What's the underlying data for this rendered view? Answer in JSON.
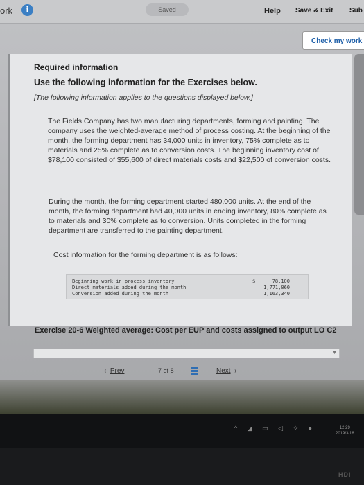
{
  "topbar": {
    "left_fragment": "ork",
    "info_glyph": "i",
    "saved_label": "Saved",
    "help_label": "Help",
    "save_exit_label": "Save & Exit",
    "submit_fragment": "Sub"
  },
  "check_button": "Check my work",
  "content": {
    "required_title": "Required information",
    "use_following": "Use the following information for the Exercises below.",
    "note": "[The following information applies to the questions displayed below.]",
    "paragraph1": "The Fields Company has two manufacturing departments, forming and painting. The company uses the weighted-average method of process costing. At the beginning of the month, the forming department has 34,000 units in inventory, 75% complete as to materials and 25% complete as to conversion costs. The beginning inventory cost of $78,100 consisted of $55,600 of direct materials costs and $22,500 of conversion costs.",
    "paragraph2": "During the month, the forming department started 480,000 units. At the end of the month, the forming department had 40,000 units in ending inventory, 80% complete as to materials and 30% complete as to conversion. Units completed in the forming department are transferred to the painting department.",
    "paragraph3": "Cost information for the forming department is as follows:",
    "cost_table": {
      "rows": [
        {
          "label": "Beginning work in process inventory",
          "value": "78,100",
          "currency": "$"
        },
        {
          "label": "Direct materials added during the month",
          "value": "1,771,060",
          "currency": ""
        },
        {
          "label": "Conversion added during the month",
          "value": "1,163,340",
          "currency": ""
        }
      ]
    }
  },
  "exercise": {
    "title": "Exercise 20-6 Weighted average: Cost per EUP and costs assigned to output LO C2"
  },
  "navigation": {
    "prev_label": "Prev",
    "page_current": "7",
    "page_of": "of",
    "page_total": "8",
    "next_label": "Next"
  },
  "taskbar": {
    "clock_time": "12:29",
    "clock_date": "2019/3/18"
  },
  "monitor_brand": "HDI"
}
